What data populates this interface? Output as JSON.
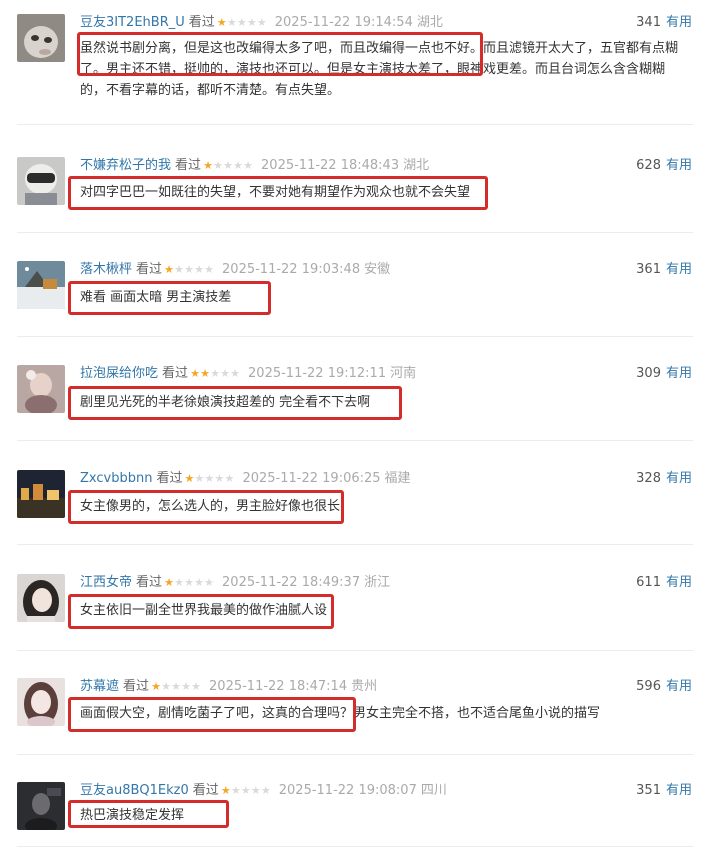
{
  "useful_label": "有用",
  "watched_label": "看过",
  "reviews": [
    {
      "user": "豆友3IT2EhBR_U",
      "stars": 1,
      "time": "2025-11-22 19:14:54",
      "location": "湖北",
      "votes": "341",
      "content": "虽然说书剧分离，但是这也改编得太多了吧，而且改编得一点也不好。而且滤镜开太大了，五官都有点糊了。男主还不错，挺帅的，演技也还可以。但是女主演技太差了，眼神戏更差。而且台词怎么含含糊糊的，不看字幕的话，都听不清楚。有点失望。"
    },
    {
      "user": "不嫌弃松子的我",
      "stars": 1,
      "time": "2025-11-22 18:48:43",
      "location": "湖北",
      "votes": "628",
      "content": "对四字巴巴一如既往的失望，不要对她有期望作为观众也就不会失望"
    },
    {
      "user": "落木楸枰",
      "stars": 1,
      "time": "2025-11-22 19:03:48",
      "location": "安徽",
      "votes": "361",
      "content": "难看 画面太暗 男主演技差"
    },
    {
      "user": "拉泡屎给你吃",
      "stars": 2,
      "time": "2025-11-22 19:12:11",
      "location": "河南",
      "votes": "309",
      "content": "剧里见光死的半老徐娘演技超差的 完全看不下去啊"
    },
    {
      "user": "Zxcvbbbnn",
      "stars": 1,
      "time": "2025-11-22 19:06:25",
      "location": "福建",
      "votes": "328",
      "content": "女主像男的，怎么选人的，男主脸好像也很长"
    },
    {
      "user": "江西女帝",
      "stars": 1,
      "time": "2025-11-22 18:49:37",
      "location": "浙江",
      "votes": "611",
      "content": "女主依旧一副全世界我最美的做作油腻人设"
    },
    {
      "user": "苏幕遮",
      "stars": 1,
      "time": "2025-11-22 18:47:14",
      "location": "贵州",
      "votes": "596",
      "content": "画面假大空，剧情吃菌子了吧，这真的合理吗？男女主完全不搭，也不适合尾鱼小说的描写"
    },
    {
      "user": "豆友au8BQ1Ekz0",
      "stars": 1,
      "time": "2025-11-22 19:08:07",
      "location": "四川",
      "votes": "351",
      "content": "热巴演技稳定发挥"
    }
  ]
}
